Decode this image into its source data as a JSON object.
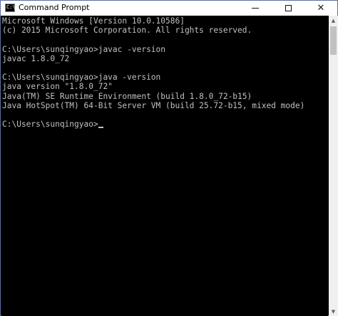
{
  "window": {
    "title": "Command Prompt",
    "icon": "cmd-icon",
    "icon_text": "C:\\",
    "controls": {
      "minimize": "minimize-icon",
      "maximize": "maximize-icon",
      "close_glyph": "✕"
    }
  },
  "console": {
    "text_color": "#c0c0c0",
    "background": "#000000",
    "lines": [
      "Microsoft Windows [Version 10.0.10586]",
      "(c) 2015 Microsoft Corporation. All rights reserved.",
      "",
      "C:\\Users\\sunqingyao>javac -version",
      "javac 1.8.0_72",
      "",
      "C:\\Users\\sunqingyao>java -version",
      "java version \"1.8.0_72\"",
      "Java(TM) SE Runtime Environment (build 1.8.0_72-b15)",
      "Java HotSpot(TM) 64-Bit Server VM (build 25.72-b15, mixed mode)",
      "",
      "C:\\Users\\sunqingyao>"
    ]
  },
  "scrollbar": {
    "up_glyph": "▲",
    "down_glyph": "▼"
  }
}
